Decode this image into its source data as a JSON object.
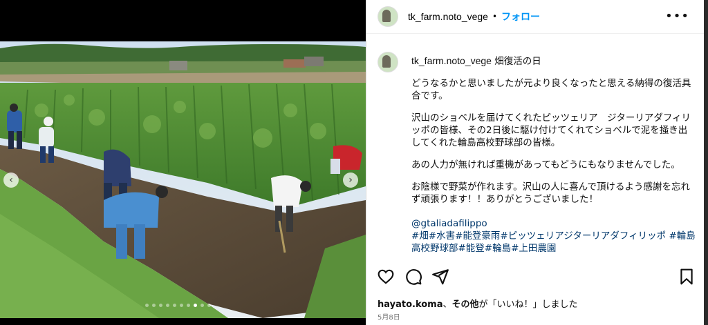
{
  "post": {
    "username": "tk_farm.noto_vege",
    "separator": "•",
    "follow_label": "フォロー",
    "more_icon": "more-horizontal-icon"
  },
  "caption": {
    "username": "tk_farm.noto_vege",
    "title": "畑復活の日",
    "paragraphs": [
      "どうなるかと思いましたが元より良くなったと思える納得の復活具合です。",
      "沢山のショベルを届けてくれたピッツェリア　ジターリアダフィリッポの皆様、その2日後に駆け付けてくれてショベルで泥を掻き出してくれた輪島高校野球部の皆様。",
      "あの人力が無ければ重機があってもどうにもなりませんでした。",
      "お陰様で野菜が作れます。沢山の人に喜んで頂けるよう感謝を忘れず頑張ります！！ありがとうございました！"
    ],
    "mention": "@gtaliadafilippo",
    "hashtags_line1": "#畑#水害#能登豪雨#ピッツェリアジターリアダフィリッポ #輪島",
    "hashtags_line2": "高校野球部#能登#輪島#上田農園"
  },
  "likes": {
    "user": "hayato.koma",
    "connector": "、",
    "others": "その他",
    "suffix": "が「いいね！」しました"
  },
  "date": "5月8日",
  "carousel": {
    "current_slide": 8,
    "total_slides": 10
  },
  "colors": {
    "link": "#00376b",
    "follow": "#0095f6"
  }
}
